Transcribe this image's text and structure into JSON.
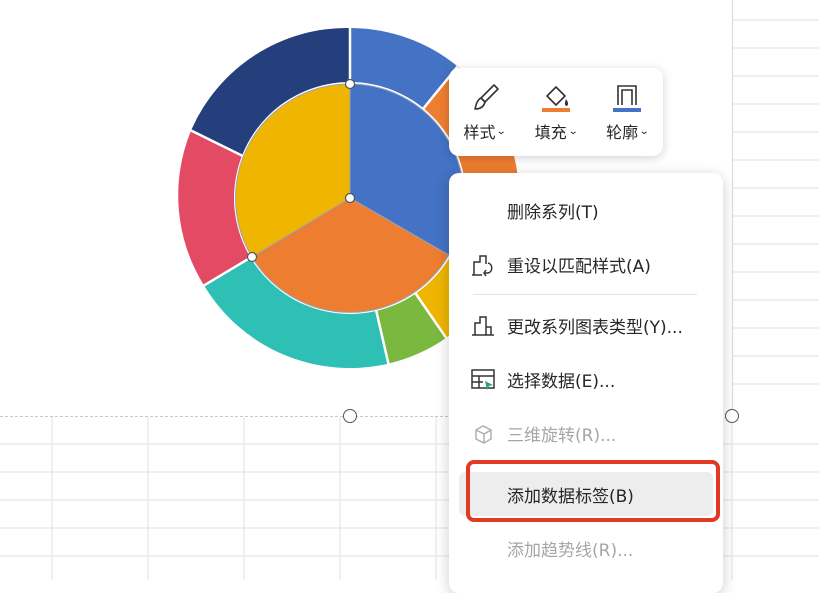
{
  "colors": {
    "outer_segments": [
      "#4472c4",
      "#ed7d31",
      "#efb500",
      "#7ab840",
      "#2ec0b4",
      "#e34b65",
      "#243f7c"
    ],
    "inner_segments": [
      "#4472c4",
      "#ed7d31",
      "#efb500"
    ],
    "highlight": "#e03a22",
    "menu_hover": "#ededed"
  },
  "toolbar": {
    "style_label": "样式",
    "fill_label": "填充",
    "outline_label": "轮廓",
    "style_icon": "paintbrush-icon",
    "fill_icon": "paint-bucket-icon",
    "outline_icon": "outline-icon"
  },
  "context_menu": {
    "items": [
      {
        "label": "删除系列(T)",
        "icon": "none",
        "enabled": true
      },
      {
        "label": "重设以匹配样式(A)",
        "icon": "reset-style-icon",
        "enabled": true
      },
      {
        "label": "更改系列图表类型(Y)...",
        "icon": "chart-type-icon",
        "enabled": true
      },
      {
        "label": "选择数据(E)...",
        "icon": "select-data-icon",
        "enabled": true
      },
      {
        "label": "三维旋转(R)...",
        "icon": "3d-rotate-icon",
        "enabled": false
      },
      {
        "label": "添加数据标签(B)",
        "icon": "none",
        "enabled": true,
        "highlighted": true
      },
      {
        "label": "添加趋势线(R)...",
        "icon": "none",
        "enabled": false
      }
    ]
  }
}
